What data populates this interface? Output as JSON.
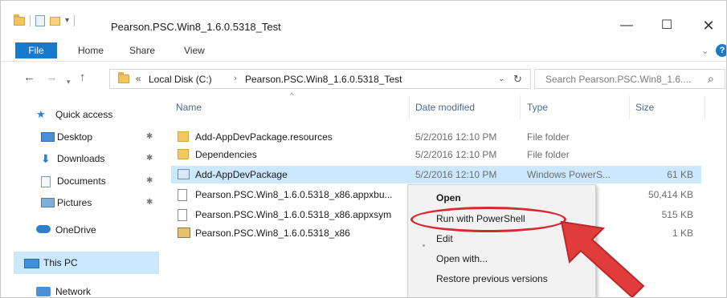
{
  "window": {
    "title": "Pearson.PSC.Win8_1.6.0.5318_Test",
    "controls": {
      "minimize": "—",
      "maximize": "☐",
      "close": "✕"
    }
  },
  "ribbon": {
    "tabs": [
      "File",
      "Home",
      "Share",
      "View"
    ],
    "file_color": "#1979ca"
  },
  "address": {
    "prefix": "«",
    "segments": [
      "Local Disk (C:)",
      "Pearson.PSC.Win8_1.6.0.5318_Test"
    ],
    "separator": "›",
    "search_placeholder": "Search Pearson.PSC.Win8_1.6...."
  },
  "navpane": {
    "quick_access": "Quick access",
    "pinned": [
      "Desktop",
      "Downloads",
      "Documents",
      "Pictures"
    ],
    "onedrive": "OneDrive",
    "this_pc": "This PC",
    "network": "Network"
  },
  "columns": {
    "name": "Name",
    "date": "Date modified",
    "type": "Type",
    "size": "Size"
  },
  "files": [
    {
      "name": "Add-AppDevPackage.resources",
      "date": "5/2/2016 12:10 PM",
      "type": "File folder",
      "size": "",
      "icon": "folder-icon"
    },
    {
      "name": "Dependencies",
      "date": "5/2/2016 12:10 PM",
      "type": "File folder",
      "size": "",
      "icon": "folder-icon"
    },
    {
      "name": "Add-AppDevPackage",
      "date": "5/2/2016 12:10 PM",
      "type": "Windows PowerS...",
      "size": "61 KB",
      "icon": "powershell-script-icon"
    },
    {
      "name": "Pearson.PSC.Win8_1.6.0.5318_x86.appxbu...",
      "date": "",
      "type": "",
      "size": "50,414 KB",
      "icon": "file-icon"
    },
    {
      "name": "Pearson.PSC.Win8_1.6.0.5318_x86.appxsym",
      "date": "",
      "type": "",
      "size": "515 KB",
      "icon": "file-icon"
    },
    {
      "name": "Pearson.PSC.Win8_1.6.0.5318_x86",
      "date": "",
      "type": "",
      "size": "1 KB",
      "icon": "package-icon"
    }
  ],
  "context_menu": {
    "items": [
      "Open",
      "Run with PowerShell",
      "Edit",
      "Open with...",
      "Restore previous versions"
    ],
    "highlight_color": "#d8292f"
  }
}
